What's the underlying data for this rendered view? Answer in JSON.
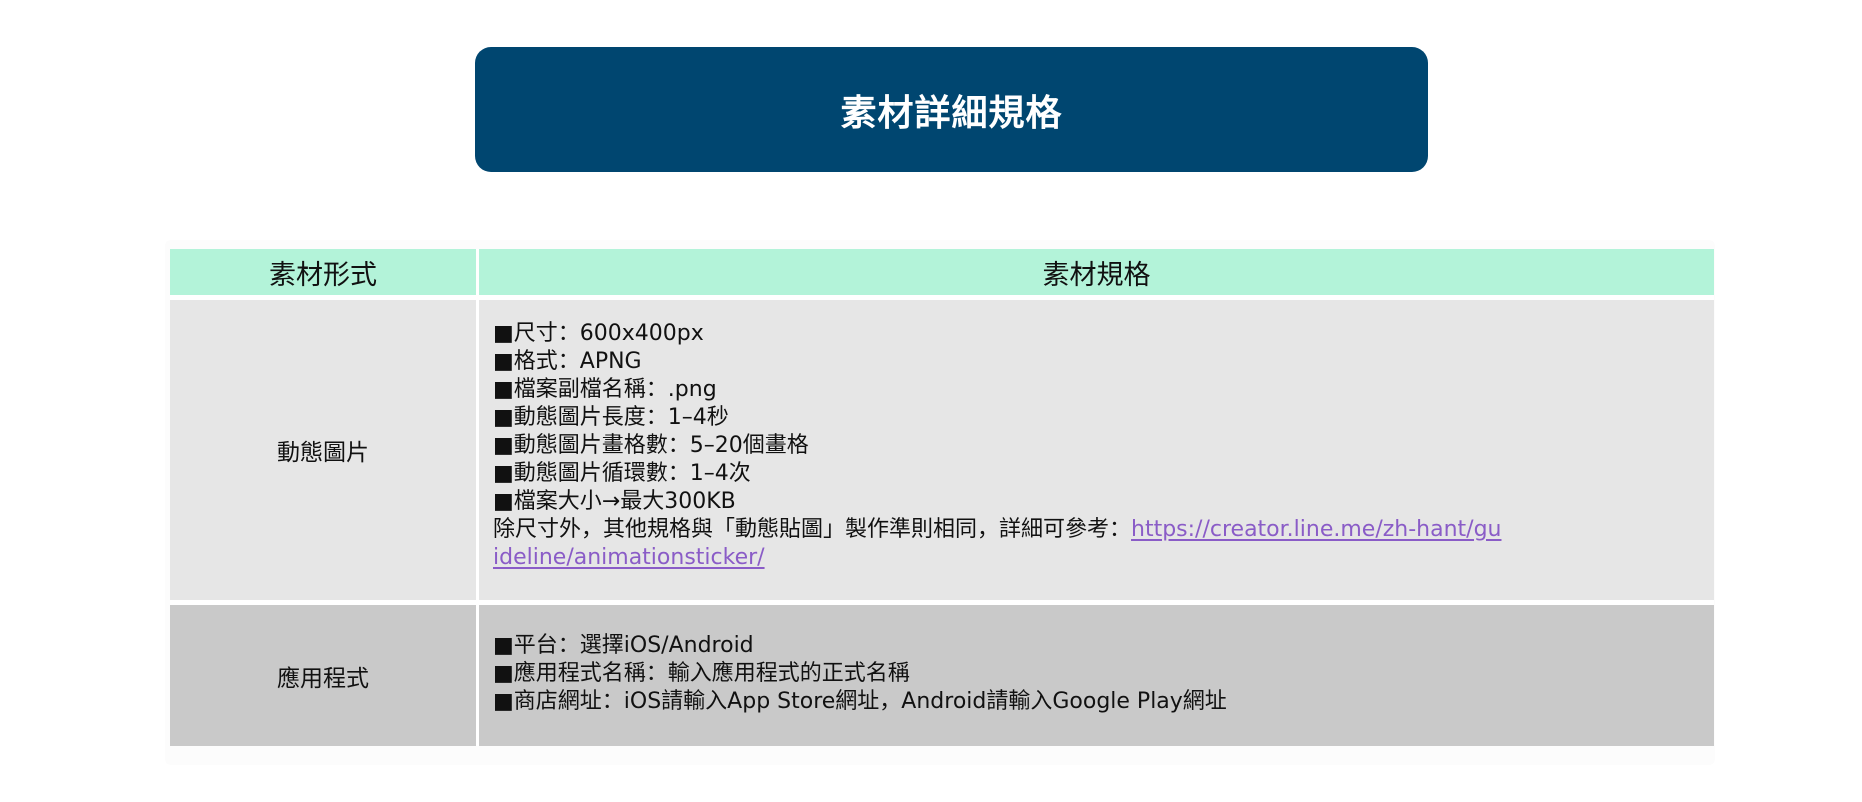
{
  "title": "素材詳細規格",
  "colors": {
    "title_bg": "#004670",
    "header_bg": "#b3f3d9",
    "row1_bg": "#e6e6e6",
    "row2_bg": "#c9c9c9",
    "link": "#8a5cc7"
  },
  "table": {
    "headers": [
      "素材形式",
      "素材規格"
    ],
    "rows": [
      {
        "type": "動態圖片",
        "specs": [
          "■尺寸：600x400px",
          "■格式：APNG",
          "■檔案副檔名稱：.png",
          "■動態圖片長度：1–4秒",
          "■動態圖片畫格數：5–20個畫格",
          "■動態圖片循環數：1–4次",
          "■檔案大小→最大300KB"
        ],
        "note_text": "除尺寸外，其他規格與「動態貼圖」製作準則相同，詳細可參考：",
        "note_link": "https://creator.line.me/zh-hant/guideline/animationsticker/"
      },
      {
        "type": "應用程式",
        "specs": [
          "■平台：選擇iOS/Android",
          "■應用程式名稱：輸入應用程式的正式名稱",
          "■商店網址：iOS請輸入App Store網址，Android請輸入Google Play網址"
        ]
      }
    ]
  }
}
